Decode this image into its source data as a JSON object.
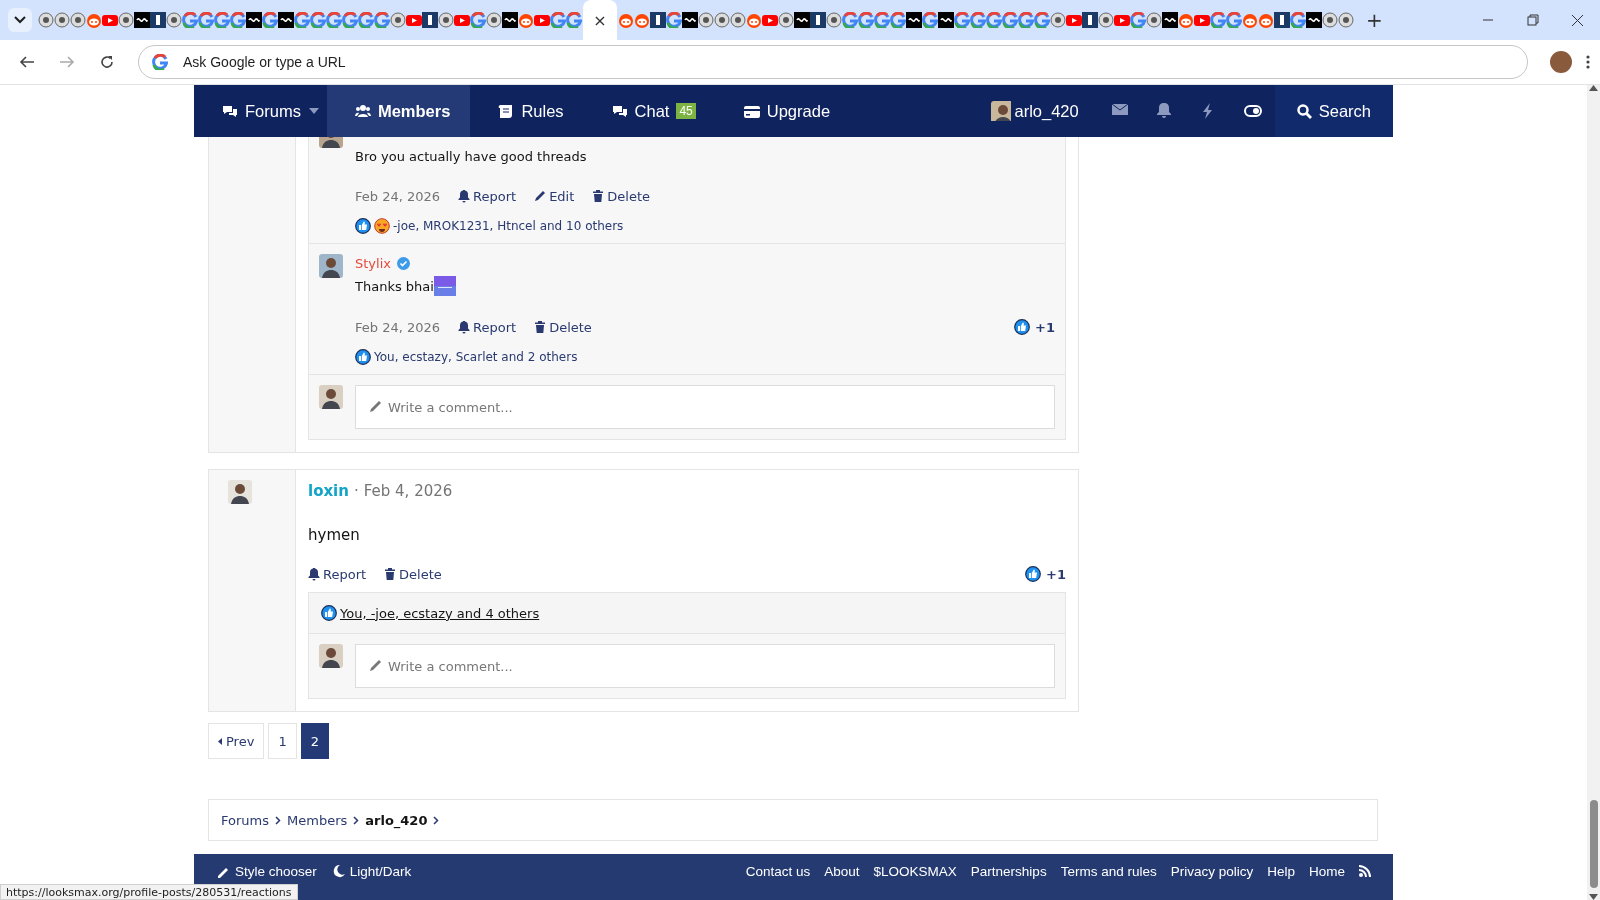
{
  "browser": {
    "tabs": [
      {
        "selected": false
      },
      {
        "selected": false
      },
      {
        "selected": false
      },
      {
        "selected": false
      },
      {
        "selected": false
      },
      {
        "selected": false
      },
      {
        "selected": false
      },
      {
        "selected": false
      },
      {
        "selected": false
      },
      {
        "selected": false
      },
      {
        "selected": false
      },
      {
        "selected": false
      },
      {
        "selected": false
      },
      {
        "selected": false
      },
      {
        "selected": false
      },
      {
        "selected": false
      },
      {
        "selected": false
      },
      {
        "selected": false
      },
      {
        "selected": false
      },
      {
        "selected": false
      },
      {
        "selected": false
      },
      {
        "selected": false
      },
      {
        "selected": false
      },
      {
        "selected": false
      },
      {
        "selected": false
      },
      {
        "selected": false
      },
      {
        "selected": false
      },
      {
        "selected": false
      },
      {
        "selected": false
      },
      {
        "selected": false
      },
      {
        "selected": false
      },
      {
        "selected": false
      },
      {
        "selected": false
      },
      {
        "selected": false
      },
      {
        "selected": true
      },
      {
        "selected": false
      },
      {
        "selected": false
      },
      {
        "selected": false
      },
      {
        "selected": false
      },
      {
        "selected": false
      },
      {
        "selected": false
      },
      {
        "selected": false
      },
      {
        "selected": false
      },
      {
        "selected": false
      },
      {
        "selected": false
      },
      {
        "selected": false
      },
      {
        "selected": false
      },
      {
        "selected": false
      },
      {
        "selected": false
      },
      {
        "selected": false
      },
      {
        "selected": false
      },
      {
        "selected": false
      },
      {
        "selected": false
      },
      {
        "selected": false
      },
      {
        "selected": false
      },
      {
        "selected": false
      },
      {
        "selected": false
      },
      {
        "selected": false
      },
      {
        "selected": false
      },
      {
        "selected": false
      },
      {
        "selected": false
      },
      {
        "selected": false
      },
      {
        "selected": false
      },
      {
        "selected": false
      },
      {
        "selected": false
      },
      {
        "selected": false
      },
      {
        "selected": false
      },
      {
        "selected": false
      },
      {
        "selected": false
      },
      {
        "selected": false
      },
      {
        "selected": false
      },
      {
        "selected": false
      },
      {
        "selected": false
      },
      {
        "selected": false
      },
      {
        "selected": false
      },
      {
        "selected": false
      },
      {
        "selected": false
      },
      {
        "selected": false
      },
      {
        "selected": false
      },
      {
        "selected": false
      },
      {
        "selected": false
      }
    ],
    "close_label": "×",
    "new_tab_label": "+",
    "address": {
      "placeholder": "Ask Google or type a URL"
    },
    "status_url": "https://looksmax.org/profile-posts/280531/reactions"
  },
  "nav": {
    "items": [
      {
        "kind": "forums",
        "label": "Forums",
        "selected": false
      },
      {
        "kind": "members",
        "label": "Members",
        "selected": true
      },
      {
        "kind": "rules",
        "label": "Rules",
        "selected": false
      },
      {
        "kind": "chat",
        "label": "Chat",
        "badge": "45",
        "selected": false
      },
      {
        "kind": "upgrade",
        "label": "Upgrade",
        "selected": false
      }
    ],
    "user": "arlo_420",
    "search": "Search"
  },
  "posts": [
    {
      "comments": [
        {
          "body": "Bro you actually have good threads",
          "date": "Feb 24, 2026",
          "actions": [
            {
              "kind": "report",
              "label": "Report"
            },
            {
              "kind": "edit",
              "label": "Edit"
            },
            {
              "kind": "delete",
              "label": "Delete"
            }
          ],
          "reactions": [
            {
              "kind": "like"
            },
            {
              "kind": "love"
            }
          ],
          "reactions_text": "-joe, MROK1231, Htncel and 10 others"
        },
        {
          "author": "Stylix",
          "verified": true,
          "body": "Thanks bhai",
          "sticker": true,
          "date": "Feb 24, 2026",
          "actions": [
            {
              "kind": "report",
              "label": "Report"
            },
            {
              "kind": "delete",
              "label": "Delete"
            }
          ],
          "reaction_count": "+1",
          "reactions": [
            {
              "kind": "like"
            }
          ],
          "reactions_text": "You, ecstazy, Scarlet and 2 others"
        }
      ],
      "comment_placeholder": "Write a comment..."
    },
    {
      "author": "loxin",
      "separator": "·",
      "date": "Feb 4, 2026",
      "body": "hymen",
      "actions": [
        {
          "kind": "report",
          "label": "Report"
        },
        {
          "kind": "delete",
          "label": "Delete"
        }
      ],
      "reaction_count": "+1",
      "reactions": [
        {
          "kind": "like"
        }
      ],
      "reactions_text": "You, -joe, ecstazy and 4 others",
      "comment_placeholder": "Write a comment..."
    }
  ],
  "pagination": {
    "prev": "Prev",
    "pages": [
      {
        "label": "1",
        "selected": false
      },
      {
        "label": "2",
        "selected": true
      }
    ]
  },
  "breadcrumb": [
    {
      "label": "Forums",
      "current": false
    },
    {
      "label": "Members",
      "current": false
    },
    {
      "label": "arlo_420",
      "current": true
    }
  ],
  "footer": {
    "left": [
      {
        "kind": "style",
        "label": "Style chooser"
      },
      {
        "kind": "theme",
        "label": "Light/Dark"
      }
    ],
    "links": [
      "Contact us",
      "About",
      "$LOOKSMAX",
      "Partnerships",
      "Terms and rules",
      "Privacy policy",
      "Help",
      "Home"
    ]
  }
}
